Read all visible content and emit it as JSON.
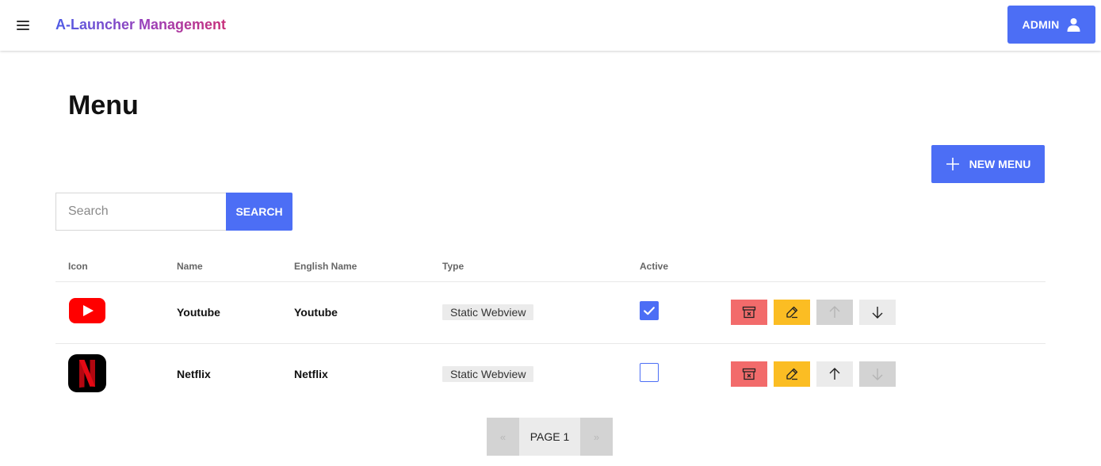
{
  "header": {
    "title": "A-Launcher Management",
    "user_label": "ADMIN",
    "menu_icon": "hamburger-icon",
    "user_icon": "user-icon"
  },
  "page": {
    "title": "Menu",
    "new_button_label": "NEW MENU"
  },
  "search": {
    "placeholder": "Search",
    "value": "",
    "button_label": "SEARCH"
  },
  "table": {
    "columns": [
      "Icon",
      "Name",
      "English Name",
      "Type",
      "Active"
    ],
    "rows": [
      {
        "icon": "youtube-logo",
        "name": "Youtube",
        "english_name": "Youtube",
        "type": "Static Webview",
        "active": true
      },
      {
        "icon": "netflix-logo",
        "name": "Netflix",
        "english_name": "Netflix",
        "type": "Static Webview",
        "active": false
      }
    ]
  },
  "pagination": {
    "prev": "«",
    "current": "PAGE 1",
    "next": "»"
  },
  "colors": {
    "primary": "#4c6ef5",
    "delete": "#f26b6b",
    "edit": "#fbbd23",
    "neutral": "#ebebeb",
    "disabled": "#d3d3d3"
  }
}
